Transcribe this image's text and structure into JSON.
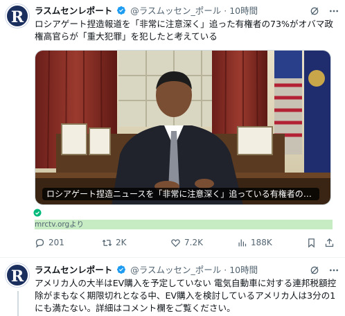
{
  "tweets": [
    {
      "author_name": "ラスムセンレポート",
      "avatar_letter": "R",
      "handle": "@ラスムッセン_ポール",
      "separator": "·",
      "time": "10時間",
      "text": "ロシアゲート捏造報道を「非常に注意深く」追った有権者の73%がオバマ政権高官らが「重大犯罪」を犯したと考えている",
      "media_caption": "ロシアゲート捏造ニュースを「非常に注意深く」追っている有権者の73%がオ...",
      "source": "mrctv.orgより",
      "stats": {
        "replies": "201",
        "retweets": "2K",
        "likes": "7.2K",
        "views": "188K"
      }
    },
    {
      "author_name": "ラスムセンレポート",
      "avatar_letter": "R",
      "handle": "@ラスムッセン_ポール",
      "separator": "·",
      "time": "10時間",
      "text": "アメリカ人の大半はEV購入を予定していない 電気自動車に対する連邦税額控除がまもなく期限切れとなる中、EV購入を検討しているアメリカ人は3分の1にも満たない。詳細はコメント欄をご覧ください。"
    }
  ],
  "colors": {
    "verified": "#1d9bf0",
    "secondary_text": "#536471",
    "source_highlight": "#c7ecc4",
    "avatar_bg": "#1b2f5e"
  },
  "icons": [
    "verified-badge-icon",
    "grok-icon",
    "more-icon",
    "check-circle-icon",
    "reply-icon",
    "retweet-icon",
    "like-icon",
    "views-icon",
    "bookmark-icon",
    "share-icon"
  ]
}
